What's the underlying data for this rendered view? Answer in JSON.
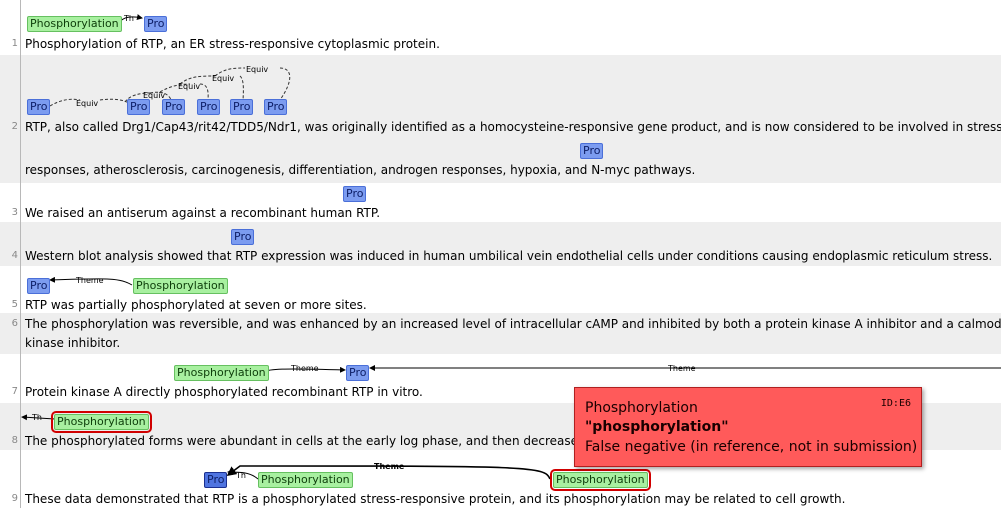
{
  "lines": [
    {
      "no": "1",
      "text": "Phosphorylation  of  RTP, an ER stress-responsive cytoplasmic protein."
    },
    {
      "no": "2",
      "text": "RTP, also called Drg1/Cap43/rit42/TDD5/Ndr1, was originally identified as a homocysteine-responsive gene product, and is now considered to be involved in stress"
    },
    {
      "no": "",
      "text": "responses, atherosclerosis, carcinogenesis, differentiation, androgen responses, hypoxia, and N-myc pathways."
    },
    {
      "no": "3",
      "text": "We raised an antiserum against a recombinant human RTP."
    },
    {
      "no": "4",
      "text": "Western blot analysis showed that RTP expression was induced in human umbilical vein endothelial cells under conditions causing endoplasmic reticulum stress."
    },
    {
      "no": "5",
      "text": "RTP was partially  phosphorylated  at seven or more sites."
    },
    {
      "no": "6",
      "text": "The phosphorylation was reversible, and was enhanced by an increased level of intracellular cAMP and inhibited by both a protein kinase A inhibitor and a calmodulin"
    },
    {
      "no": "",
      "text": "kinase inhibitor."
    },
    {
      "no": "7",
      "text": "Protein kinase A directly  phosphorylated  recombinant RTP in vitro."
    },
    {
      "no": "8",
      "text": "The  phosphorylated  forms were abundant in cells at the early log phase, and then decreased with cell density..."
    },
    {
      "no": "9",
      "text": "These data demonstrated that RTP is a  phosphorylated  stress-responsive protein, and its  phosphorylation  may be related to cell growth."
    }
  ],
  "labels": {
    "phosphorylation": "Phosphorylation",
    "protein": "Pro"
  },
  "arc_labels": {
    "th": "Th",
    "theme": "Theme",
    "equiv": "Equiv"
  },
  "tooltip": {
    "type": "Phosphorylation",
    "text": "\"phosphorylation\"",
    "status": "False negative (in reference, not in submission)",
    "id": "ID:E6"
  },
  "colors": {
    "protein": "#7c9cf0",
    "phosphorylation": "#a8f0a0",
    "error_border": "#d00000",
    "tooltip_bg": "#ff5a5a"
  }
}
